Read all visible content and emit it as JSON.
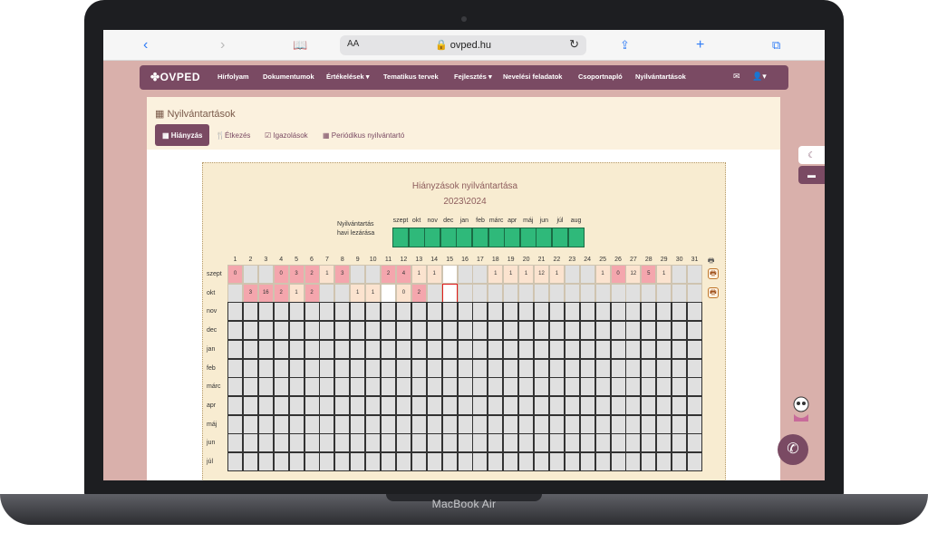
{
  "device": {
    "label": "MacBook Air"
  },
  "browser": {
    "back_icon": "chevron-left",
    "forward_icon": "chevron-right",
    "reader_icon": "book",
    "aa_label": "AA",
    "url": "ovped.hu",
    "reload_icon": "reload",
    "share_icon": "share",
    "newtab_icon": "plus",
    "tabs_icon": "tabs"
  },
  "navbar": {
    "brand": "OVPED",
    "items": [
      "Hírfolyam",
      "Dokumentumok",
      "Értékelések",
      "Tematikus tervek",
      "Fejlesztés",
      "Nevelési feladatok",
      "Csoportnapló",
      "Nyilvántartások"
    ],
    "dropdown_items": [
      "Értékelések",
      "Fejlesztés"
    ],
    "mail_icon": "envelope",
    "user_icon": "user",
    "color": "#7a4a63"
  },
  "panel": {
    "title": "Nyilvántartások",
    "tabs": [
      "Hiányzás",
      "Étkezés",
      "Igazolások",
      "Periódikus nyilvántartó"
    ],
    "active_tab": "Hiányzás"
  },
  "attendance": {
    "title": "Hiányzások nyilvántartása",
    "year": "2023\\2024",
    "lock_label_line1": "Nyilvántartás",
    "lock_label_line2": "havi lezárása",
    "months": [
      "szept",
      "okt",
      "nov",
      "dec",
      "jan",
      "feb",
      "márc",
      "apr",
      "máj",
      "jun",
      "júl",
      "aug"
    ],
    "days": [
      "1",
      "2",
      "3",
      "4",
      "5",
      "6",
      "7",
      "8",
      "9",
      "10",
      "11",
      "12",
      "13",
      "14",
      "15",
      "16",
      "17",
      "18",
      "19",
      "20",
      "21",
      "22",
      "23",
      "24",
      "25",
      "26",
      "27",
      "28",
      "29",
      "30",
      "31"
    ],
    "rows": [
      {
        "label": "szept",
        "cells": [
          "0",
          "",
          "",
          "0",
          "3",
          "2",
          "1",
          "3",
          "",
          "",
          "2",
          "4",
          "1",
          "1",
          "",
          "",
          "",
          "1",
          "1",
          "1",
          "12",
          "1",
          "",
          "",
          "1",
          "0",
          "12",
          "5",
          "1",
          "",
          ""
        ]
      },
      {
        "label": "okt",
        "cells": [
          "",
          "3",
          "16",
          "2",
          "1",
          "2",
          "",
          "",
          "1",
          "1",
          "",
          "0",
          "2",
          "",
          "",
          "",
          "",
          "",
          "",
          "",
          "",
          "",
          "",
          "",
          "",
          "",
          "",
          "",
          "",
          "",
          ""
        ]
      },
      {
        "label": "nov",
        "cells": []
      },
      {
        "label": "dec",
        "cells": []
      },
      {
        "label": "jan",
        "cells": []
      },
      {
        "label": "feb",
        "cells": []
      },
      {
        "label": "márc",
        "cells": []
      },
      {
        "label": "apr",
        "cells": []
      },
      {
        "label": "máj",
        "cells": []
      },
      {
        "label": "jun",
        "cells": []
      },
      {
        "label": "júl",
        "cells": []
      }
    ],
    "colors": {
      "absent": "#f4a6ad",
      "present": "#fbe3cf",
      "weekend": "#e0e0e0",
      "empty": "#ffffff",
      "today_border": "#e02020",
      "locked": "#2fb97a"
    }
  },
  "widgets": {
    "moon_icon": "moon",
    "chat_icon": "chat",
    "messenger_icon": "messenger"
  }
}
